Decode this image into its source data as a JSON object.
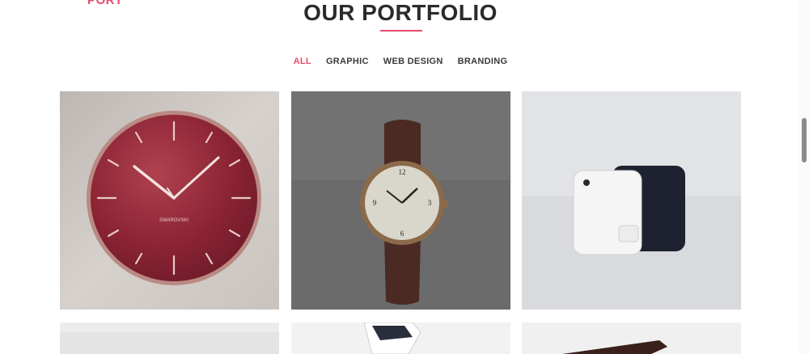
{
  "header": {
    "logo_fragment": "PORT",
    "title": "OUR PORTFOLIO"
  },
  "filters": [
    {
      "label": "ALL",
      "active": true
    },
    {
      "label": "GRAPHIC",
      "active": false
    },
    {
      "label": "WEB DESIGN",
      "active": false
    },
    {
      "label": "BRANDING",
      "active": false
    }
  ],
  "items": [
    {
      "subject": "wall-clock",
      "clock_brand": "SWAROVSKI"
    },
    {
      "subject": "wrist-watch"
    },
    {
      "subject": "tracker-device"
    },
    {
      "subject": "object-partial"
    },
    {
      "subject": "sneaker-partial"
    },
    {
      "subject": "object-partial"
    }
  ],
  "colors": {
    "accent": "#e84a6a",
    "title": "#2b2b2b",
    "filter_text": "#3a3a3a"
  }
}
